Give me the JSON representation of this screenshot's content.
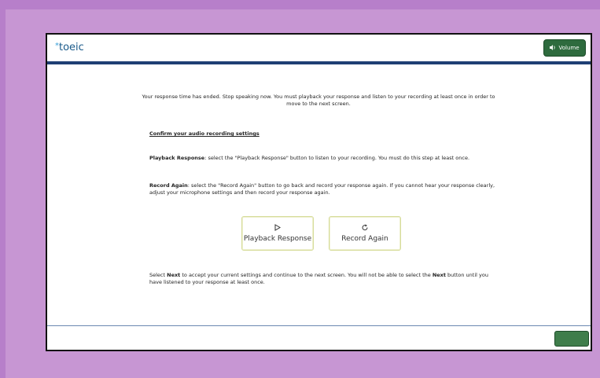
{
  "header": {
    "logo_star": "*",
    "logo_text": "toeic",
    "volume_icon": "speaker-icon",
    "volume_label": "Volume"
  },
  "main": {
    "intro_text": "Your response time has ended. Stop speaking now. You must playback your response and listen to your recording at least once in order to move to the next screen.",
    "confirm_heading": "Confirm your audio recording settings",
    "playback_label": "Playback Response",
    "playback_desc": ": select the \"Playback Response\" button to listen to your recording. You must do this step at least once.",
    "record_label": "Record Again",
    "record_desc": ": select the \"Record Again\" button to go back and record your response again. If you cannot hear your response clearly, adjust your microphone settings and then record your response again.",
    "buttons": {
      "playback": {
        "label": "Playback Response",
        "icon": "play-icon"
      },
      "record": {
        "label": "Record Again",
        "icon": "redo-icon"
      }
    },
    "next_text_1": "Select ",
    "next_word": "Next",
    "next_text_2": " to accept your current settings and continue to the next screen. You will not be able to select the ",
    "next_text_3": " button until you have listened to your response at least once."
  },
  "colors": {
    "background": "#c796d3",
    "header_bar": "#1f3f74",
    "accent_green": "#2e6b3e"
  }
}
